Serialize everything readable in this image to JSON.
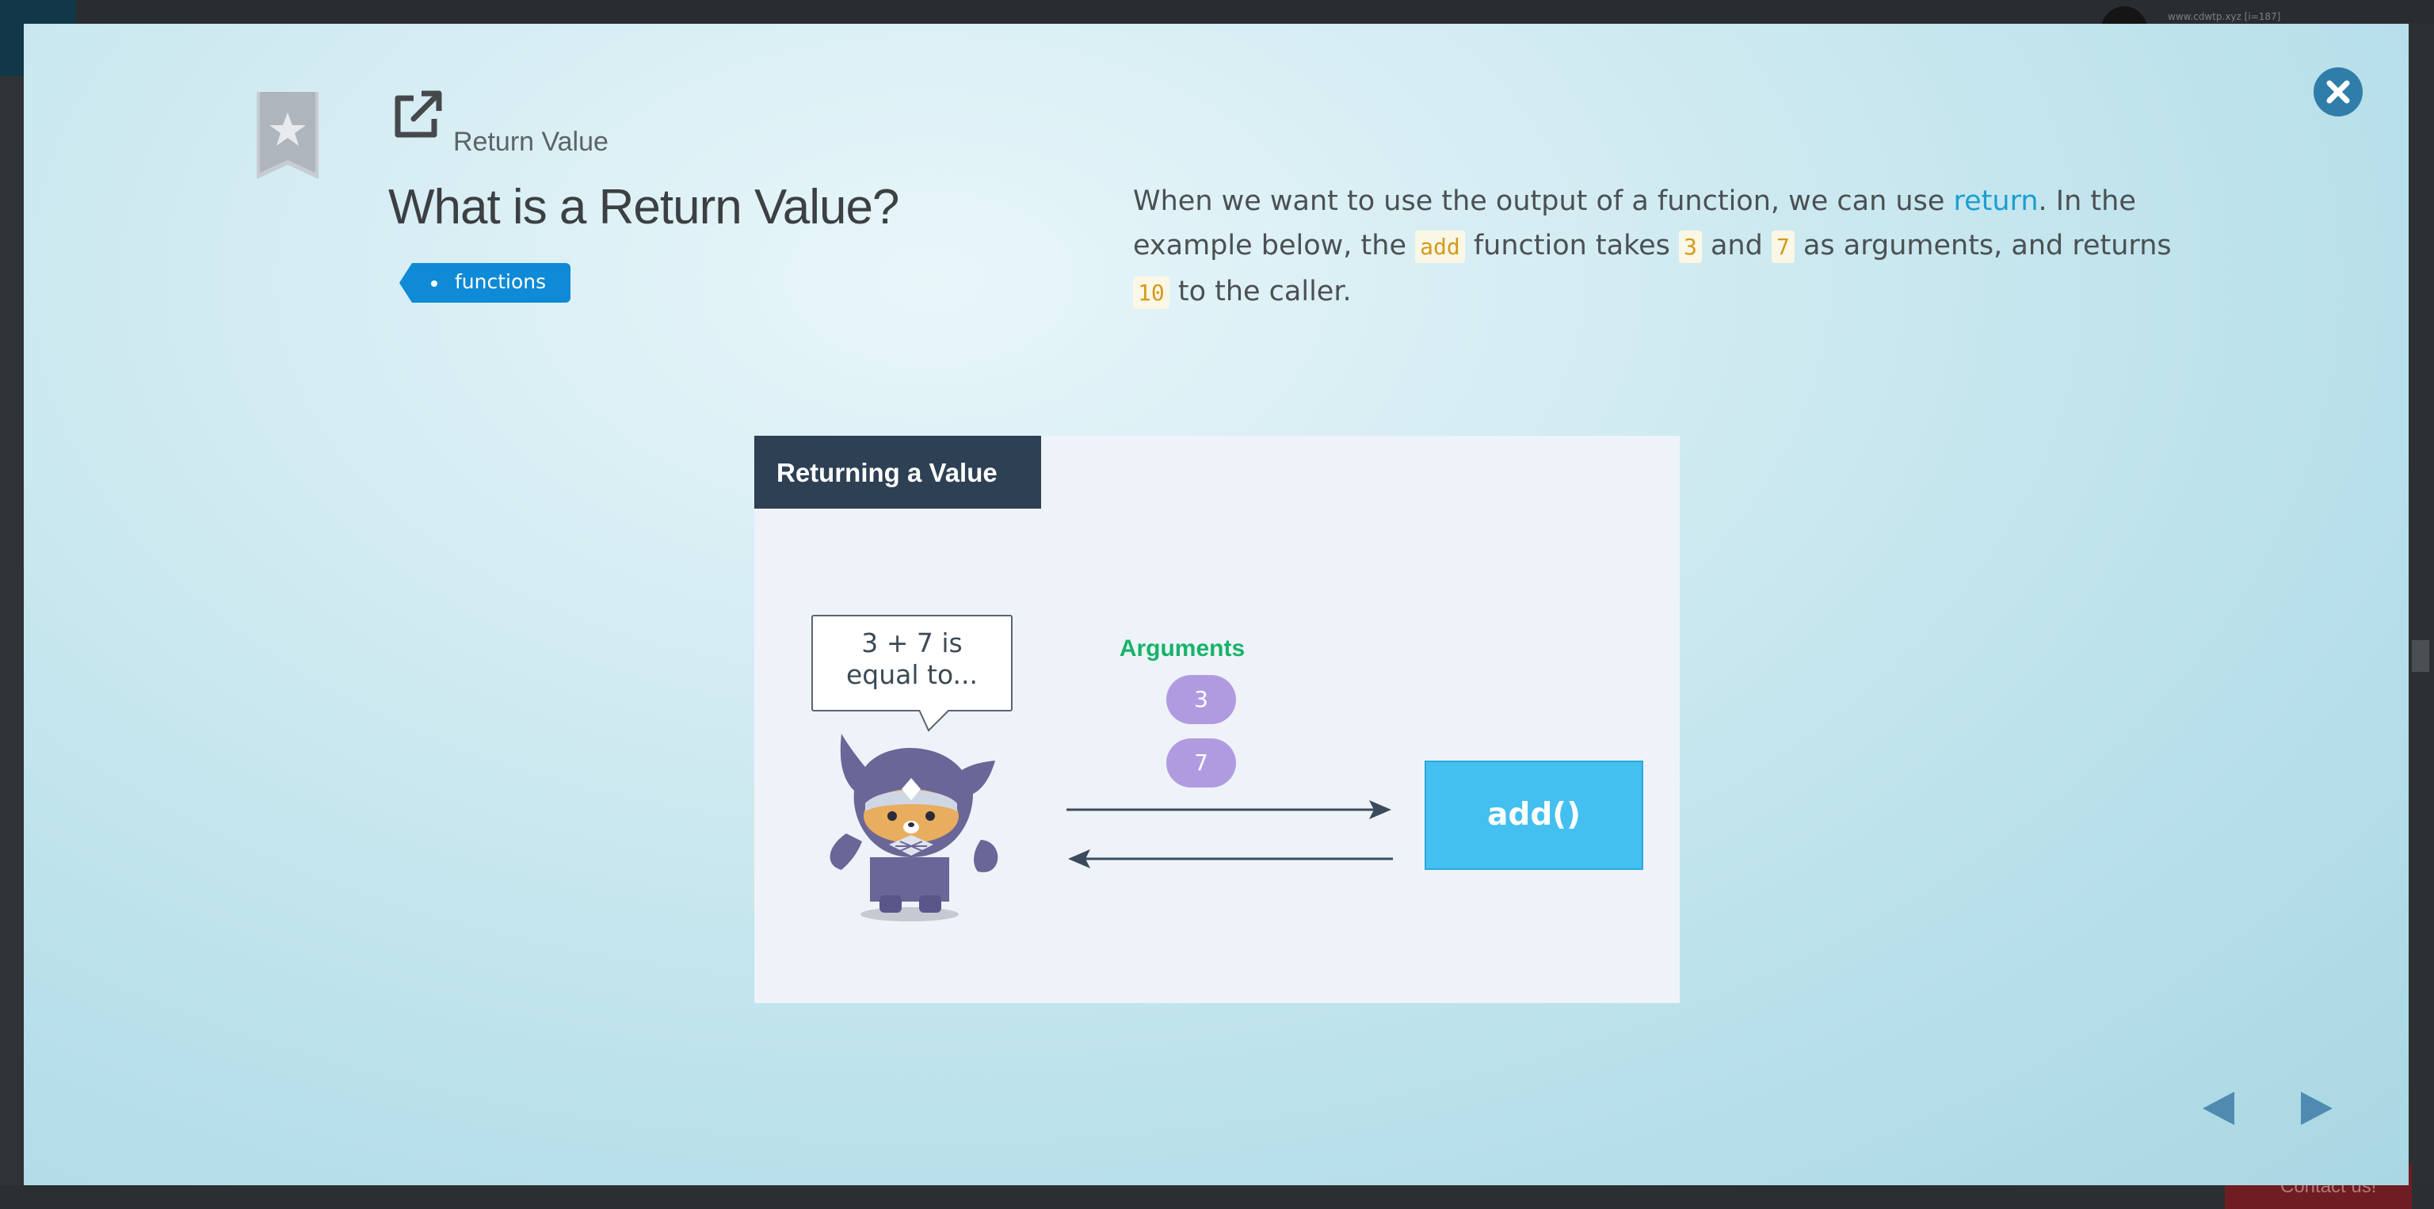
{
  "background": {
    "address_text": "www.cdwtp.xyz [i=187]",
    "contact_label": "Contact us!"
  },
  "modal": {
    "section_label": "Return Value",
    "title": "What is a Return Value?",
    "tag": "functions",
    "description": {
      "part1": "When we want to use the output of a function, we can use ",
      "keyword": "return",
      "part2": ". In the example below, the ",
      "code_add": "add",
      "part3": " function takes ",
      "code_3": "3",
      "part4": " and ",
      "code_7": "7",
      "part5": " as arguments, and returns ",
      "code_10": "10",
      "part6": " to the caller."
    },
    "diagram": {
      "title": "Returning a Value",
      "bubble_line1": "3 + 7 is",
      "bubble_line2": "equal to...",
      "arguments_label": "Arguments",
      "arg1": "3",
      "arg2": "7",
      "function_label": "add()"
    },
    "icons": {
      "bookmark": "bookmark-star-icon",
      "close": "close-icon",
      "external_link": "external-link-icon",
      "prev": "arrow-left-icon",
      "next": "arrow-right-icon"
    },
    "colors": {
      "accent": "#1c9ed1",
      "tag": "#0e8ad6",
      "close": "#2f7da9",
      "diagram_header": "#2e4053",
      "arguments": "#17b36a",
      "arg_pill": "#b19be0",
      "function_box": "#43bff0",
      "nav_arrow": "#4f8ab1"
    }
  }
}
